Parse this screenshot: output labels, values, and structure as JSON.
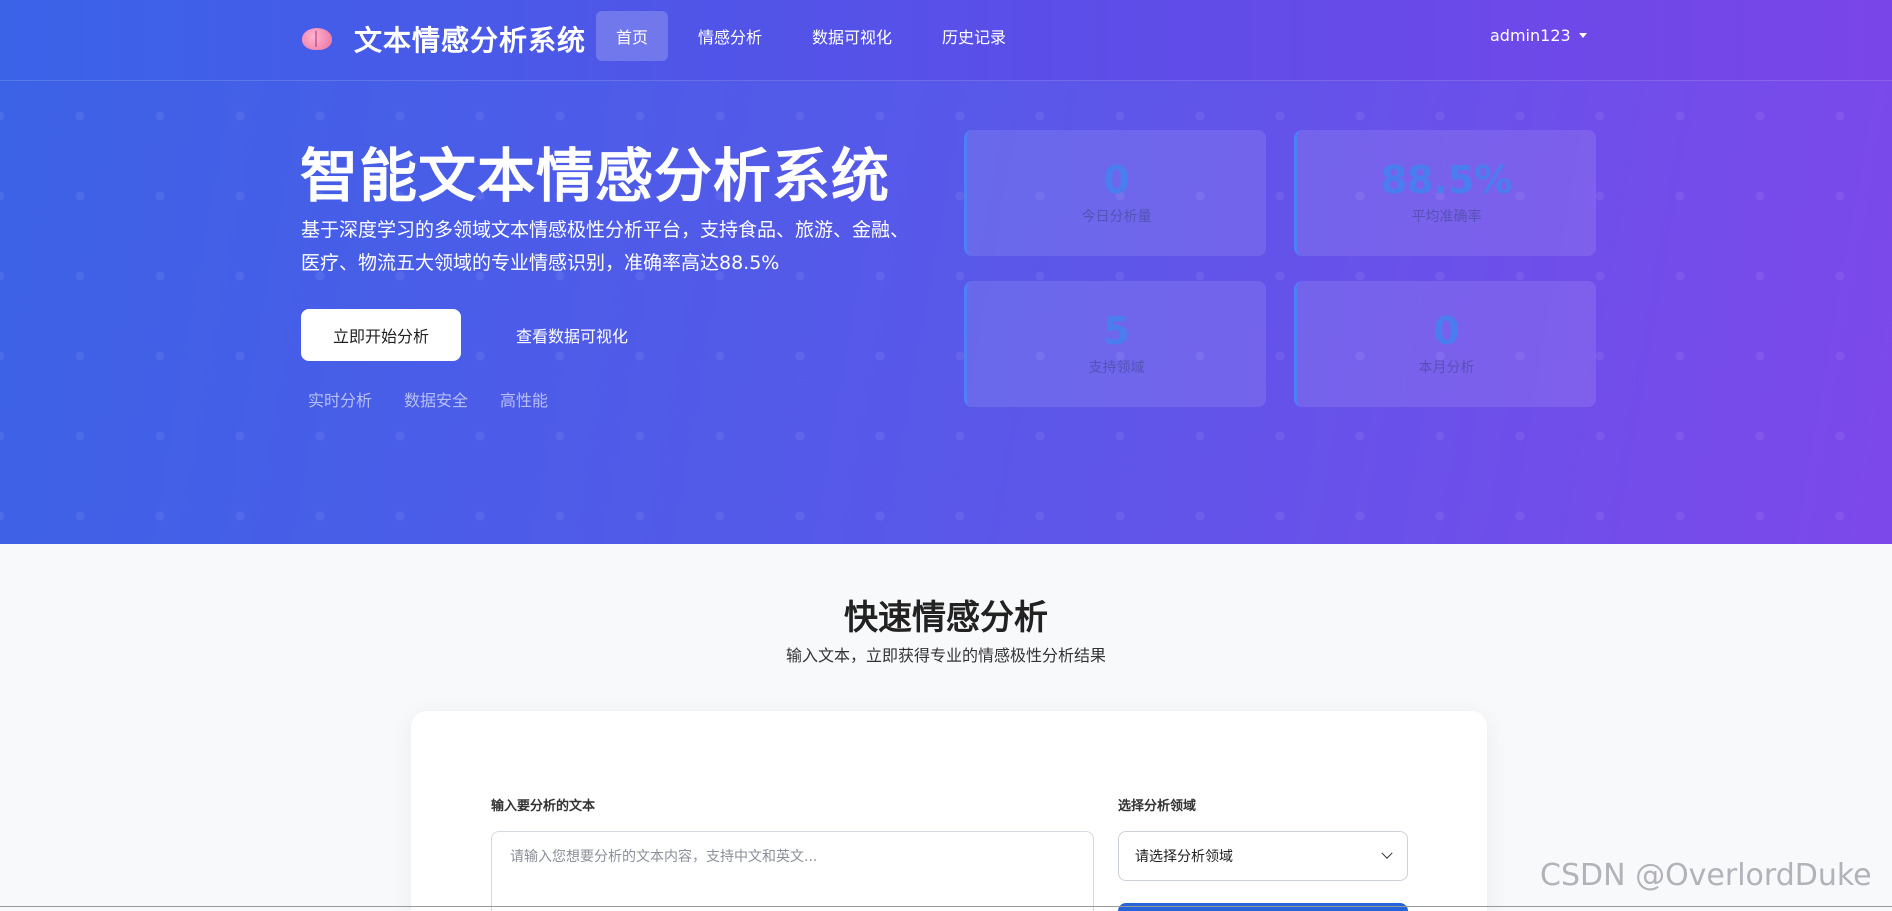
{
  "navbar": {
    "brand_title": "文本情感分析系统",
    "items": [
      "首页",
      "情感分析",
      "数据可视化",
      "历史记录"
    ],
    "active_index": 0,
    "user": "admin123"
  },
  "hero": {
    "title": "智能文本情感分析系统",
    "description": "基于深度学习的多领域文本情感极性分析平台，支持食品、旅游、金融、医疗、物流五大领域的专业情感识别，准确率高达88.5%",
    "primary_button": "立即开始分析",
    "secondary_button": "查看数据可视化",
    "features": [
      "实时分析",
      "数据安全",
      "高性能"
    ],
    "stats": [
      {
        "value": "0",
        "label": "今日分析量"
      },
      {
        "value": "88.5%",
        "label": "平均准确率"
      },
      {
        "value": "5",
        "label": "支持领域"
      },
      {
        "value": "0",
        "label": "本月分析"
      }
    ]
  },
  "quick": {
    "title": "快速情感分析",
    "subtitle": "输入文本，立即获得专业的情感极性分析结果",
    "text_label": "输入要分析的文本",
    "text_placeholder": "请输入您想要分析的文本内容，支持中文和英文...",
    "domain_label": "选择分析领域",
    "domain_selected": "请选择分析领域"
  },
  "colors": {
    "accent": "#4a7ef0",
    "primary": "#2563d8"
  },
  "watermark": "CSDN @OverlordDuke"
}
